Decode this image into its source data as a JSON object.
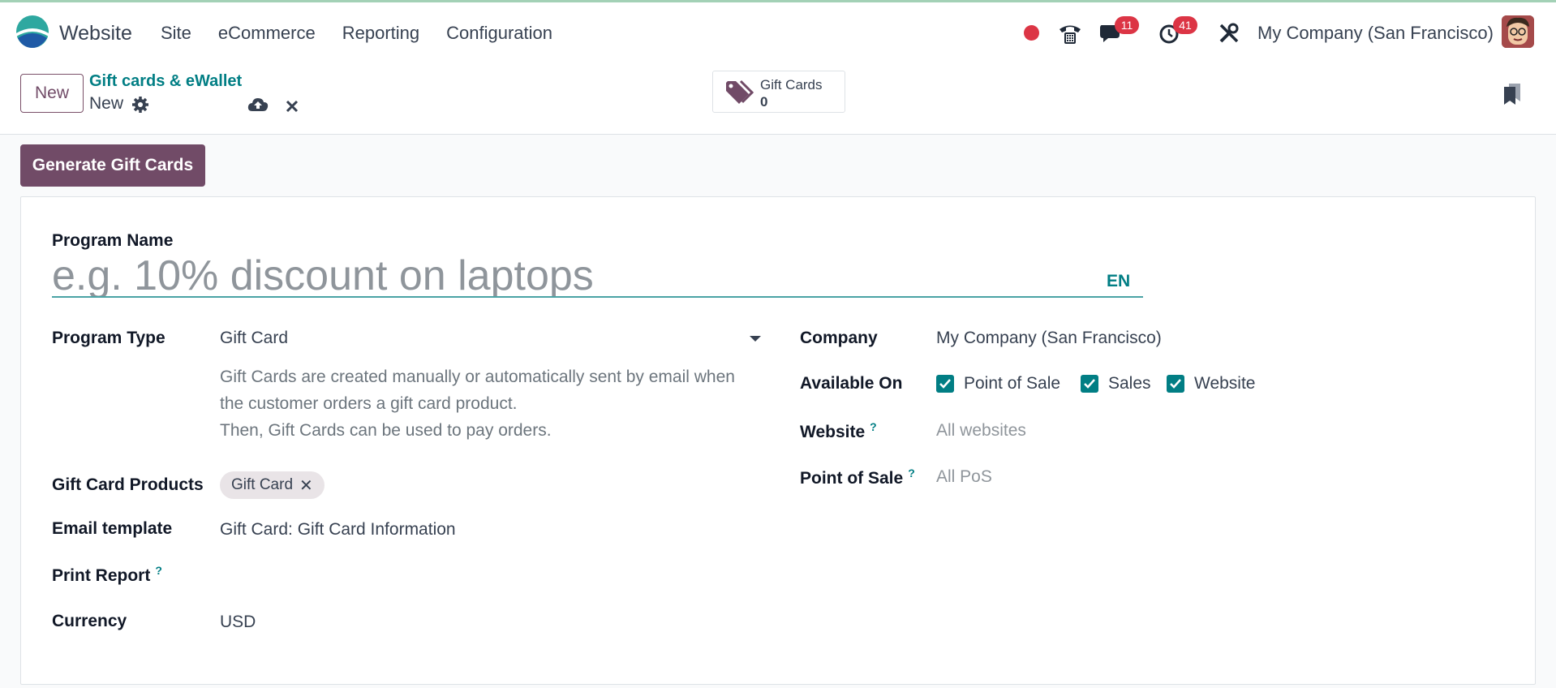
{
  "navbar": {
    "app_name": "Website",
    "menu": [
      "Site",
      "eCommerce",
      "Reporting",
      "Configuration"
    ],
    "messages_badge": "11",
    "activities_badge": "41",
    "company": "My Company (San Francisco)"
  },
  "control_panel": {
    "new_label": "New",
    "breadcrumb_parent": "Gift cards & eWallet",
    "breadcrumb_current": "New",
    "smart_button": {
      "label": "Gift Cards",
      "value": "0"
    }
  },
  "actions": {
    "generate_label": "Generate Gift Cards"
  },
  "form": {
    "program_name_label": "Program Name",
    "program_name_placeholder": "e.g. 10% discount on laptops",
    "lang": "EN",
    "program_type_label": "Program Type",
    "program_type_value": "Gift Card",
    "description_lines": [
      "Gift Cards are created manually or automatically sent by email when",
      "the customer orders a gift card product.",
      "Then, Gift Cards can be used to pay orders."
    ],
    "gift_card_products_label": "Gift Card Products",
    "gift_card_product_tag": "Gift Card",
    "email_template_label": "Email template",
    "email_template_value": "Gift Card: Gift Card Information",
    "print_report_label": "Print Report",
    "currency_label": "Currency",
    "currency_value": "USD",
    "company_label": "Company",
    "company_value": "My Company (San Francisco)",
    "available_on_label": "Available On",
    "available_on": [
      {
        "label": "Point of Sale",
        "checked": true
      },
      {
        "label": "Sales",
        "checked": true
      },
      {
        "label": "Website",
        "checked": true
      }
    ],
    "website_label": "Website",
    "website_placeholder": "All websites",
    "pos_label": "Point of Sale",
    "pos_placeholder": "All PoS",
    "help_mark": "?"
  },
  "colors": {
    "brand": "#714b67",
    "accent": "#017e84",
    "badge": "#dc3545"
  }
}
